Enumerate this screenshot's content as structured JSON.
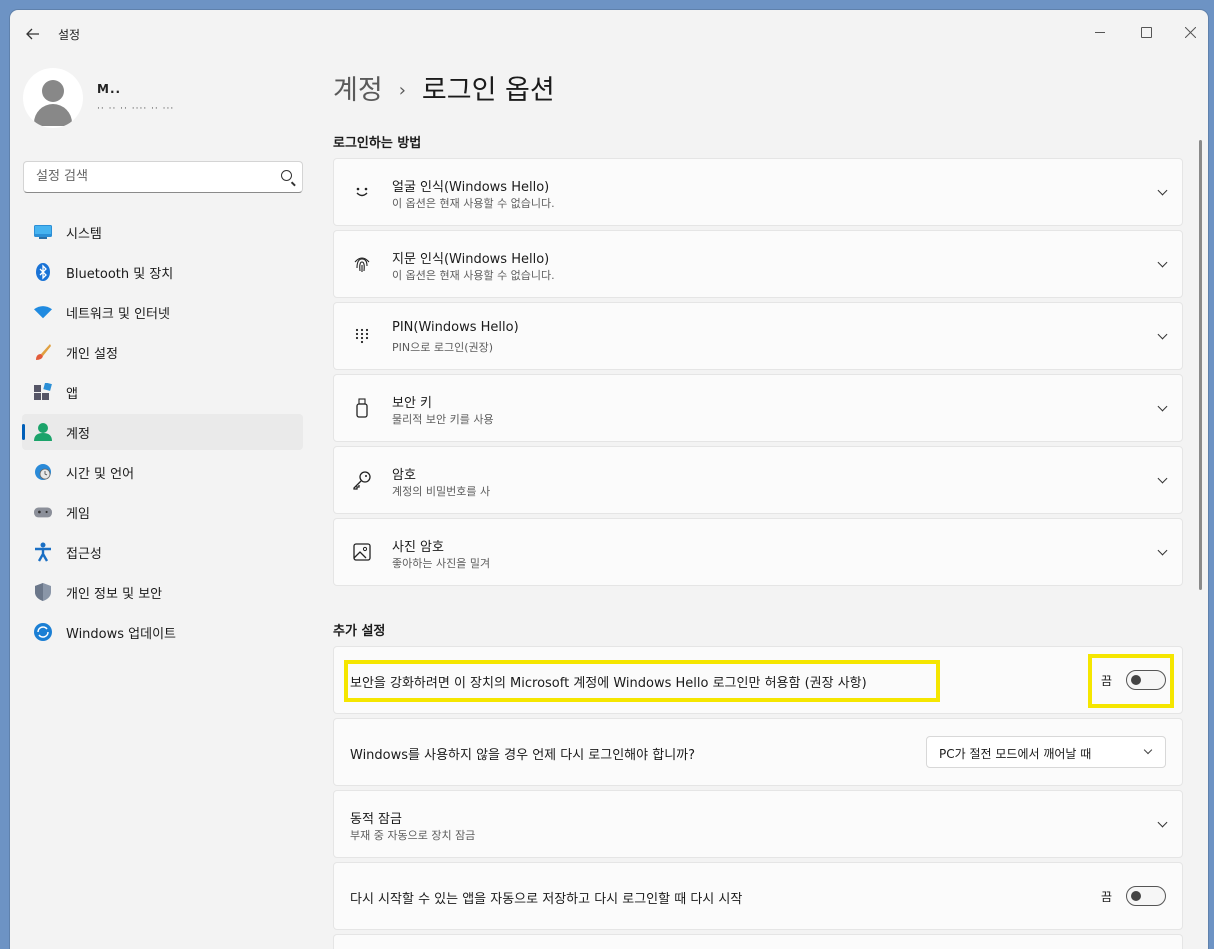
{
  "window": {
    "title": "설정"
  },
  "profile": {
    "name": "M..",
    "email": "·· ·· ·· ···· ·· ···"
  },
  "search": {
    "placeholder": "설정 검색"
  },
  "nav": [
    {
      "label": "시스템",
      "icon": "monitor-icon"
    },
    {
      "label": "Bluetooth 및 장치",
      "icon": "bluetooth-icon"
    },
    {
      "label": "네트워크 및 인터넷",
      "icon": "wifi-icon"
    },
    {
      "label": "개인 설정",
      "icon": "brush-icon"
    },
    {
      "label": "앱",
      "icon": "apps-icon"
    },
    {
      "label": "계정",
      "icon": "account-icon",
      "active": true
    },
    {
      "label": "시간 및 언어",
      "icon": "globe-clock-icon"
    },
    {
      "label": "게임",
      "icon": "gamepad-icon"
    },
    {
      "label": "접근성",
      "icon": "accessibility-icon"
    },
    {
      "label": "개인 정보 및 보안",
      "icon": "shield-icon"
    },
    {
      "label": "Windows 업데이트",
      "icon": "update-icon"
    }
  ],
  "breadcrumb": {
    "parent": "계정",
    "separator": "›",
    "current": "로그인 옵션"
  },
  "signin": {
    "title": "로그인하는 방법",
    "items": [
      {
        "title": "얼굴 인식(Windows Hello)",
        "desc": "이 옵션은 현재 사용할 수 없습니다.",
        "icon": "face-icon"
      },
      {
        "title": "지문 인식(Windows Hello)",
        "desc": "이 옵션은 현재 사용할 수 없습니다.",
        "icon": "fingerprint-icon"
      },
      {
        "title": "PIN(Windows Hello)",
        "desc": "PIN으로 로그인(권장)",
        "icon": "keypad-icon"
      },
      {
        "title": "보안 키",
        "desc": "물리적 보안 키를 사용",
        "icon": "usb-key-icon"
      },
      {
        "title": "암호",
        "desc": "계정의 비밀번호를 사",
        "icon": "key-icon"
      },
      {
        "title": "사진 암호",
        "desc": "좋아하는 사진을 밀겨",
        "icon": "picture-icon"
      }
    ]
  },
  "additional": {
    "title": "추가 설정",
    "hello_only": {
      "label": "보안을 강화하려면 이 장치의 Microsoft 계정에 Windows Hello 로그인만 허용함 (권장 사항)",
      "toggle_state": "끔"
    },
    "require_signin": {
      "label": "Windows를 사용하지 않을 경우 언제 다시 로그인해야 합니까?",
      "selected": "PC가 절전 모드에서 깨어날 때"
    },
    "dynamic_lock": {
      "title": "동적 잠금",
      "desc": "부재 중 자동으로 장치 잠금"
    },
    "restart_apps": {
      "label": "다시 시작할 수 있는 앱을 자동으로 저장하고 다시 로그인할 때 다시 시작",
      "toggle_state": "끔"
    }
  },
  "colors": {
    "accent": "#005fb8",
    "highlight": "#f5e600"
  }
}
